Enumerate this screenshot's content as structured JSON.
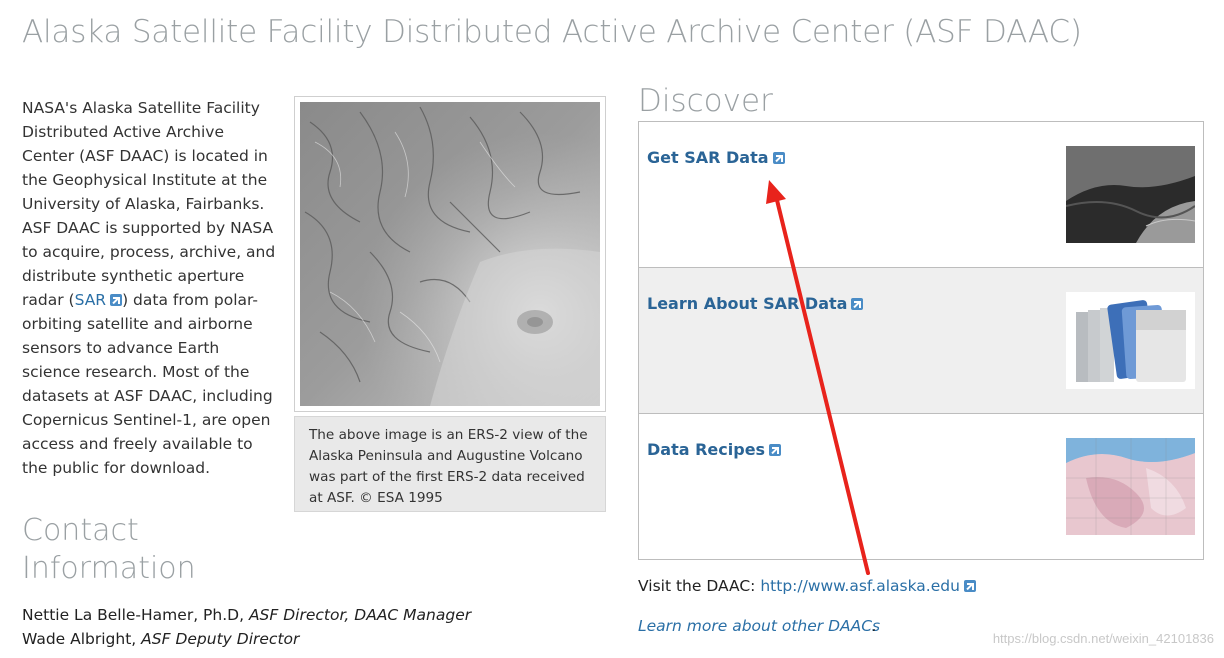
{
  "page": {
    "title": "Alaska Satellite Facility Distributed Active Archive Center (ASF DAAC)"
  },
  "intro": {
    "text_before_link": "NASA's Alaska Satellite Facility Distributed Active Archive Center (ASF DAAC) is located in the Geophysical Institute at the University of Alaska, Fairbanks. ASF DAAC is supported by NASA to acquire, process, archive, and distribute synthetic aperture radar (",
    "link_label": "SAR",
    "text_after_link": ") data from polar-orbiting satellite and airborne sensors to advance Earth science research. Most of the datasets at ASF DAAC, including Copernicus Sentinel-1, are open access and freely available to the public for download."
  },
  "figure": {
    "caption": "The above image is an ERS-2 view of the Alaska Peninsula and Augustine Volcano was part of the first ERS-2 data received at ASF. © ESA 1995"
  },
  "contact": {
    "heading": "Contact Information",
    "people": [
      {
        "name": "Nettie La Belle-Hamer, Ph.D,",
        "role": "ASF Director, DAAC Manager"
      },
      {
        "name": "Wade Albright,",
        "role": "ASF Deputy Director"
      }
    ]
  },
  "discover": {
    "heading": "Discover",
    "items": [
      {
        "label": "Get SAR Data",
        "icon": "external-link-icon"
      },
      {
        "label": "Learn About SAR Data",
        "icon": "external-link-icon"
      },
      {
        "label": "Data Recipes",
        "icon": "external-link-icon"
      }
    ]
  },
  "footer": {
    "visit_prefix": "Visit the DAAC:",
    "visit_link": "http://www.asf.alaska.edu",
    "learn_more_link": "Learn more about other DAACs",
    "learn_more_suffix": "."
  },
  "watermark": "https://blog.csdn.net/weixin_42101836",
  "colors": {
    "heading_gray": "#9aa0a3",
    "link_blue": "#2a6496",
    "annotation_red": "#e8231c"
  }
}
